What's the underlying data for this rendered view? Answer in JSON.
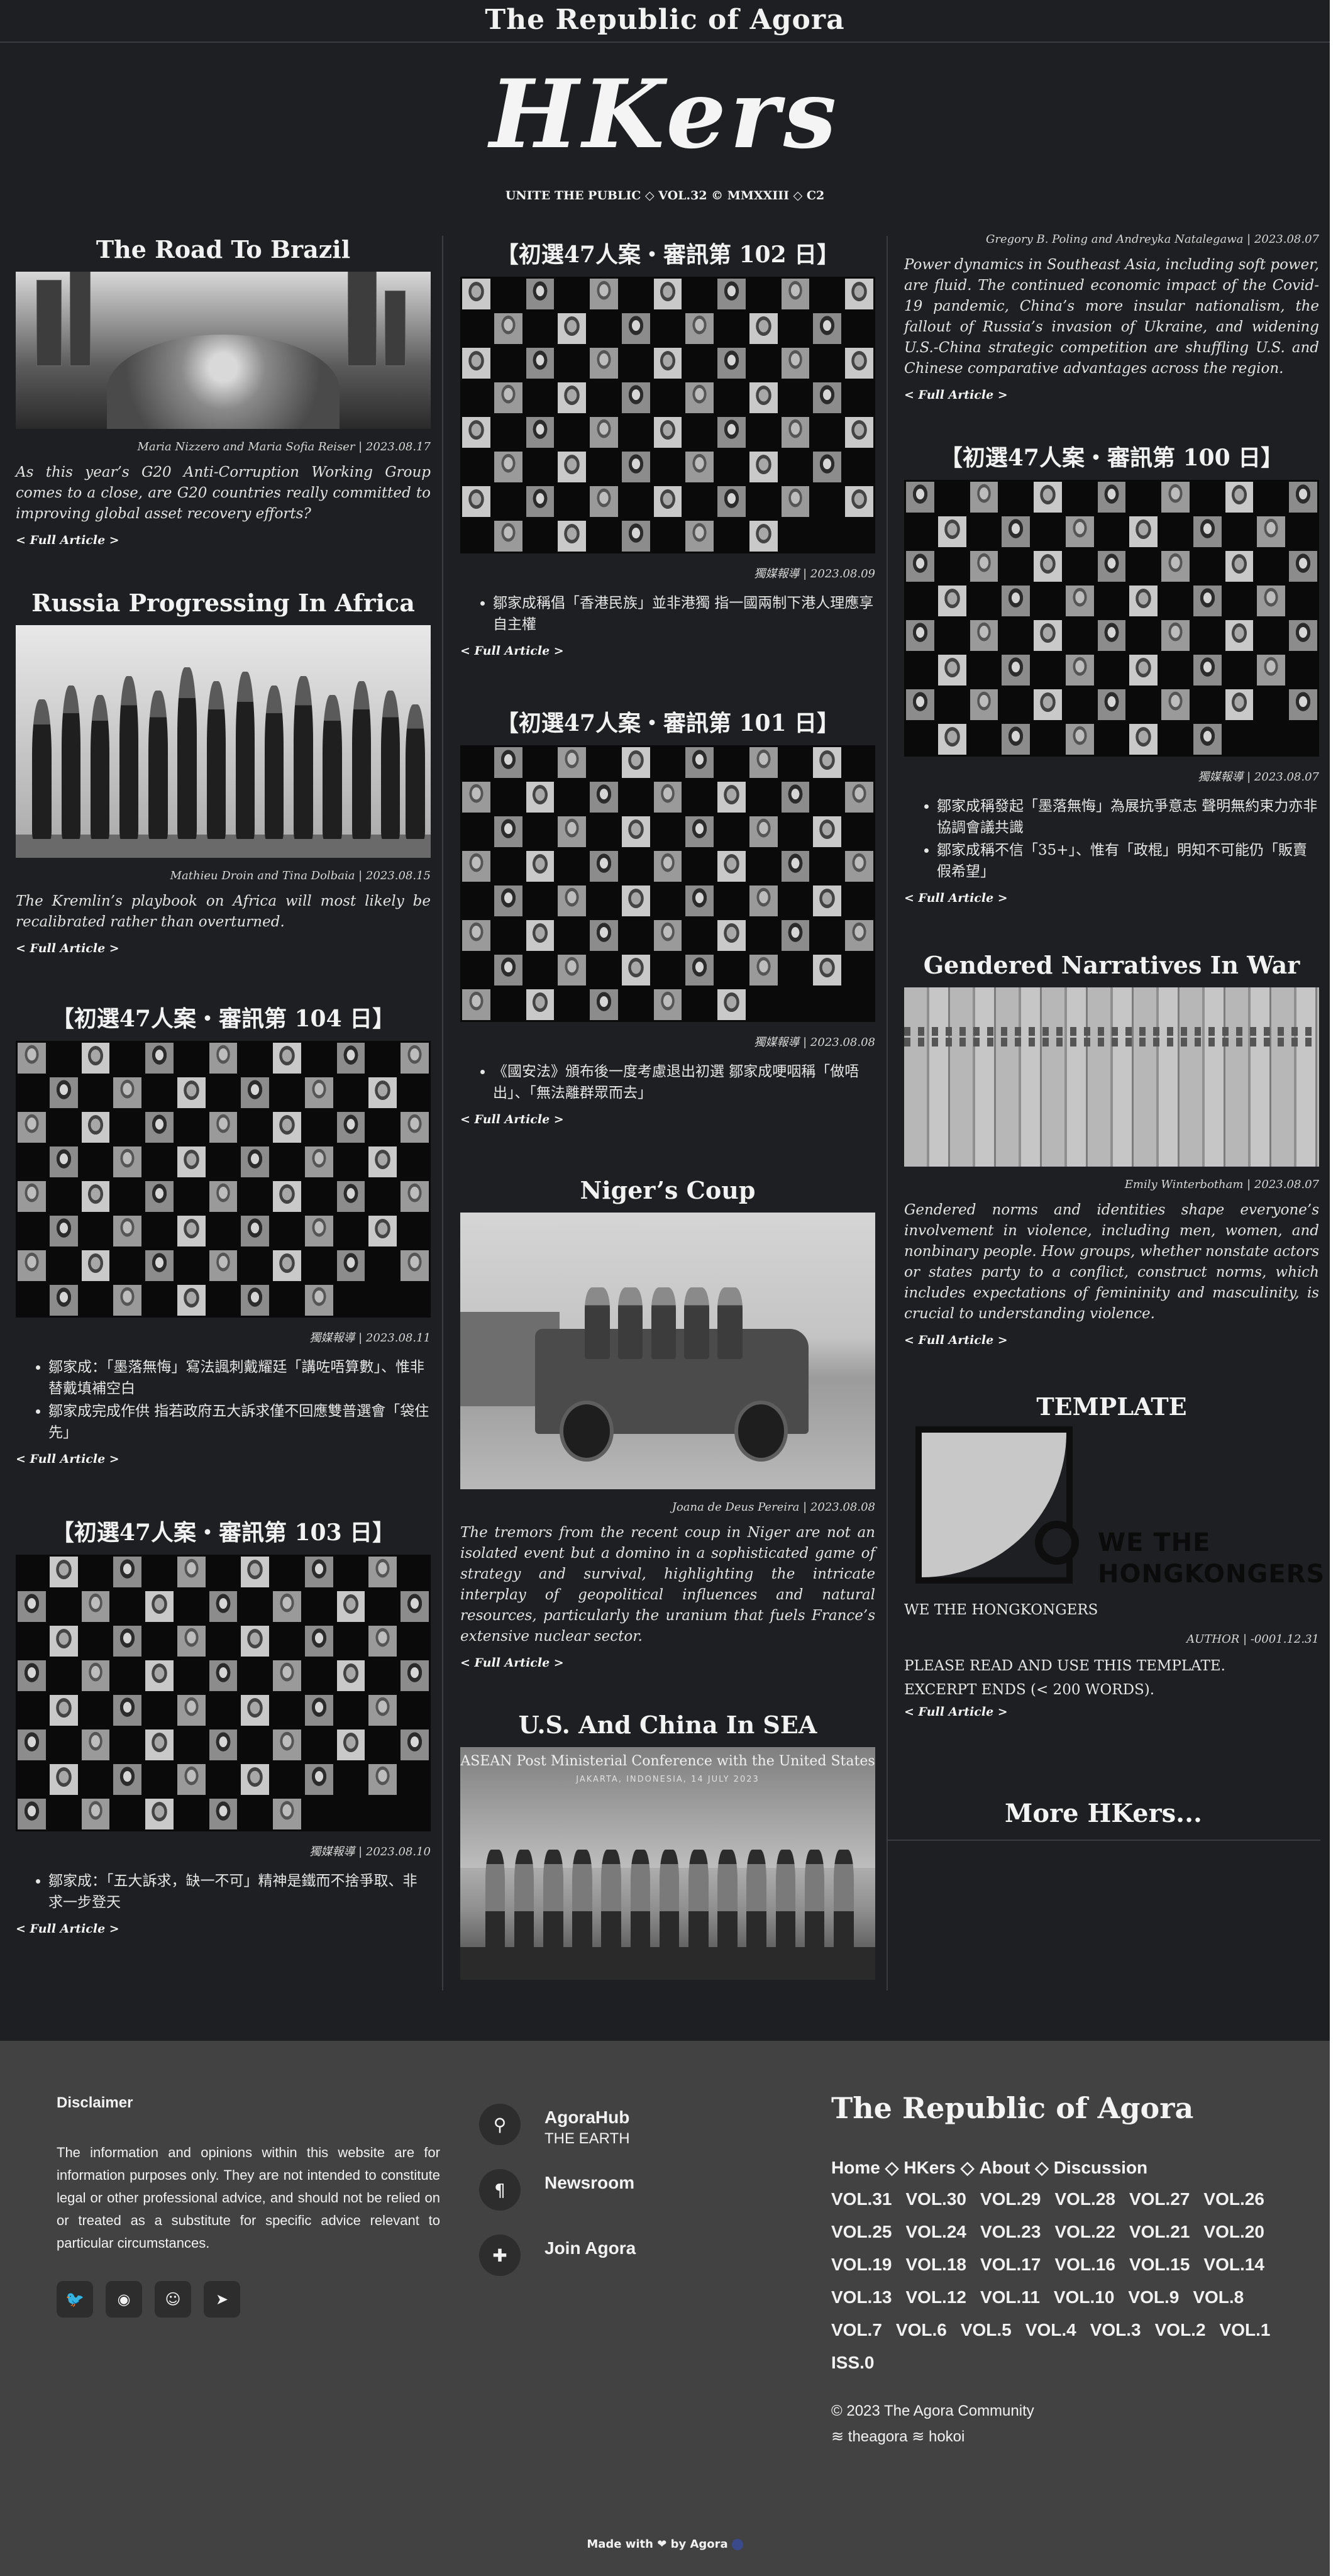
{
  "site_title": "The Republic of Agora",
  "masthead": "HKers",
  "issue_line": "UNITE THE PUBLIC ◇ VOL.32 © MMXXIII ◇ C2",
  "read_more": "< Full Article >",
  "articles": {
    "road_to_brazil": {
      "title": "The Road To Brazil",
      "byline": "Maria Nizzero and Maria Sofia Reiser | 2023.08.17",
      "excerpt": "As this year’s G20 Anti-Corruption Working Group comes to a close, are G20 countries really committed to improving global asset recovery efforts?"
    },
    "russia_africa": {
      "title": "Russia Progressing In Africa",
      "byline": "Mathieu Droin and Tina Dolbaia | 2023.08.15",
      "excerpt": "The Kremlin’s playbook on Africa will most likely be recalibrated rather than overturned."
    },
    "day104": {
      "title": "【初選47人案・審訊第 104 日】",
      "byline": "獨媒報導 | 2023.08.11",
      "bullets": [
        "鄒家成：「墨落無悔」寫法諷刺戴耀廷「講咗唔算數」、惟非替戴填補空白",
        "鄒家成完成作供 指若政府五大訴求僅不回應雙普選會「袋住先」"
      ]
    },
    "day103": {
      "title": "【初選47人案・審訊第 103 日】",
      "byline": "獨媒報導 | 2023.08.10",
      "bullets": [
        "鄒家成：「五大訴求，缺一不可」精神是鐵而不捨爭取、非求一步登天"
      ]
    },
    "day102": {
      "title": "【初選47人案・審訊第 102 日】",
      "byline": "獨媒報導 | 2023.08.09",
      "bullets": [
        "鄒家成稱倡「香港民族」並非港獨 指一國兩制下港人理應享自主權"
      ]
    },
    "day101": {
      "title": "【初選47人案・審訊第 101 日】",
      "byline": "獨媒報導 | 2023.08.08",
      "bullets": [
        "《國安法》頒布後一度考慮退出初選 鄒家成哽咽稱「做唔出」、「無法離群眾而去」"
      ]
    },
    "niger": {
      "title": "Niger’s Coup",
      "byline": "Joana de Deus Pereira | 2023.08.08",
      "excerpt": "The tremors from the recent coup in Niger are not an isolated event but a domino in a sophisticated game of strategy and survival, highlighting the intricate interplay of geopolitical influences and natural resources, particularly the uranium that fuels France’s extensive nuclear sector."
    },
    "us_china": {
      "title": "U.S. And China In SEA",
      "image_banner": "ASEAN Post Ministerial Conference with the United States",
      "image_sub": "JAKARTA, INDONESIA, 14 JULY 2023",
      "byline": "Gregory B. Poling and Andreyka Natalegawa | 2023.08.07",
      "excerpt": "Power dynamics in Southeast Asia, including soft power, are fluid. The continued economic impact of the Covid-19 pandemic, China’s more insular nationalism, the fallout of Russia’s invasion of Ukraine, and widening U.S.-China strategic competition are shuffling U.S. and Chinese comparative advantages across the region."
    },
    "day100": {
      "title": "【初選47人案・審訊第 100 日】",
      "byline": "獨媒報導 | 2023.08.07",
      "bullets": [
        "鄒家成稱發起「墨落無悔」為展抗爭意志 聲明無約束力亦非協調會議共識",
        "鄒家成稱不信「35+」、惟有「政棍」明知不可能仍「販賣假希望」"
      ]
    },
    "gendered": {
      "title": "Gendered Narratives In War",
      "byline": "Emily Winterbotham | 2023.08.07",
      "excerpt": "Gendered norms and identities shape everyone’s involvement in violence, including men, women, and nonbinary people. How groups, whether nonstate actors or states party to a conflict, construct norms, which includes expectations of femininity and masculinity, is crucial to understanding violence."
    },
    "template": {
      "title": "TEMPLATE",
      "logo_text_1": "WE THE",
      "logo_text_2": "HONGKONGERS",
      "caption": "WE THE HONGKONGERS",
      "byline": "AUTHOR | -0001.12.31",
      "line1": "PLEASE READ AND USE THIS TEMPLATE.",
      "line2": "EXCERPT ENDS (< 200 WORDS)."
    }
  },
  "more_hkers": "More HKers...",
  "footer": {
    "disclaimer_title": "Disclaimer",
    "disclaimer_text": "The information and opinions within this website are for information purposes only. They are not intended to constitute legal or other professional advice, and should not be relied on or treated as a substitute for specific advice relevant to particular circumstances.",
    "links": [
      {
        "label": "AgoraHub",
        "sub": "THE EARTH"
      },
      {
        "label": "Newsroom"
      },
      {
        "label": "Join Agora"
      }
    ],
    "brand": "The Republic of Agora",
    "nav": [
      "Home",
      "HKers",
      "About",
      "Discussion"
    ],
    "nav_sep": "◇",
    "volumes": [
      "VOL.31",
      "VOL.30",
      "VOL.29",
      "VOL.28",
      "VOL.27",
      "VOL.26",
      "VOL.25",
      "VOL.24",
      "VOL.23",
      "VOL.22",
      "VOL.21",
      "VOL.20",
      "VOL.19",
      "VOL.18",
      "VOL.17",
      "VOL.16",
      "VOL.15",
      "VOL.14",
      "VOL.13",
      "VOL.12",
      "VOL.11",
      "VOL.10",
      "VOL.9",
      "VOL.8",
      "VOL.7",
      "VOL.6",
      "VOL.5",
      "VOL.4",
      "VOL.3",
      "VOL.2",
      "VOL.1",
      "ISS.0"
    ],
    "copyright": "© 2023 The Agora Community",
    "credits": "≋ theagora ≋ hokoi",
    "made_with": "Made with ❤ by Agora"
  }
}
